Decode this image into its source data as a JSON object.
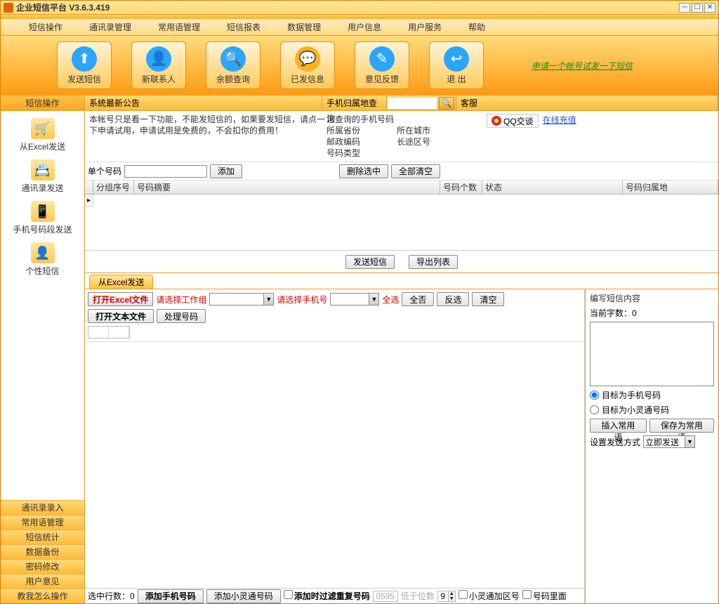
{
  "window": {
    "title": "企业短信平台  V3.6.3.419"
  },
  "menu": [
    "短信操作",
    "通讯录管理",
    "常用语管理",
    "短信报表",
    "数据管理",
    "用户信息",
    "用户服务",
    "帮助"
  ],
  "toolbar": [
    {
      "label": "发送短信",
      "color": "#2aa6ff"
    },
    {
      "label": "新联系人",
      "color": "#2aa6ff"
    },
    {
      "label": "余额查询",
      "color": "#2aa6ff"
    },
    {
      "label": "已发信息",
      "color": "#ffb020"
    },
    {
      "label": "意见反馈",
      "color": "#2aa6ff"
    },
    {
      "label": "退  出",
      "color": "#2aa6ff"
    }
  ],
  "slogan": "申请一个帐号试发一下短信",
  "sidebar": {
    "header": "短信操作",
    "items": [
      {
        "label": "从Excel发送",
        "icon": "🛒"
      },
      {
        "label": "通讯录发送",
        "icon": "📇"
      },
      {
        "label": "手机号码段发送",
        "icon": "📱"
      },
      {
        "label": "个性短信",
        "icon": "👤"
      }
    ],
    "bottom": [
      "通讯录录入",
      "常用语管理",
      "短信统计",
      "数据备份",
      "密码修改",
      "用户意见",
      "教我怎么操作"
    ]
  },
  "header_row": {
    "announce": "系统最新公告",
    "phone_loc": "手机归属地查询",
    "service": "客服"
  },
  "notice": "本帐号只是看一下功能，不能发短信的，如果要发短信，请点一下申请试用，申请试用是免费的，不会扣你的费用！",
  "lookup": {
    "l1a": "您查询的手机号码",
    "l1b": "",
    "l2a": "所属省份",
    "l2b": "所在城市",
    "l3a": "邮政编码",
    "l3b": "长途区号",
    "l4a": "号码类型",
    "l4b": ""
  },
  "qq_label": "QQ交谈",
  "recharge": "在线充值",
  "single_num": "单个号码",
  "add": "添加",
  "delete_sel": "删除选中",
  "clear_all": "全部清空",
  "grid_cols": [
    "",
    "分组序号",
    "号码摘要",
    "号码个数",
    "状态",
    "号码归属地"
  ],
  "send_sms": "发送短信",
  "export_list": "导出列表",
  "tab_label": "从Excel发送",
  "excel": {
    "open_excel": "打开Excel文件",
    "choose_group": "请选择工作组",
    "choose_phone": "请选择手机号",
    "select_all": "全选",
    "select_none": "全否",
    "invert": "反选",
    "clear": "清空",
    "open_text": "打开文本文件",
    "process": "处理号码"
  },
  "compose": {
    "title": "编写短信内容",
    "count_label": "当前字数：",
    "count_val": "0",
    "radio_mobile": "目标为手机号码",
    "radio_phs": "目标为小灵通号码",
    "insert": "插入常用语",
    "save": "保存为常用语",
    "mode_label": "设置发送方式",
    "mode_val": "立即发送"
  },
  "bottom": {
    "selected_rows": "选中行数：0",
    "add_mobile": "添加手机号码",
    "add_phs": "添加小灵通号码",
    "dedupe": "添加时过滤重复号码",
    "sample": "0595",
    "less_than": "低于位数",
    "digits": "9",
    "phs_area": "小灵通加区号",
    "in_number": "号码里面"
  }
}
